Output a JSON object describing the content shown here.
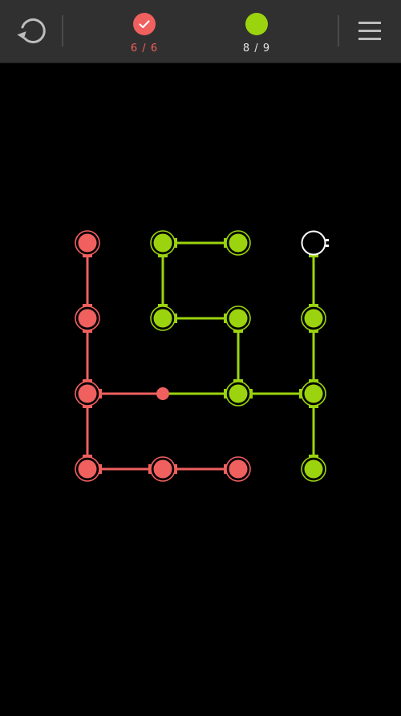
{
  "toolbar": {
    "undo_icon": "undo-arrow-icon",
    "menu_icon": "hamburger-menu-icon"
  },
  "status": {
    "red": {
      "count_text": "6 / 6",
      "color": "#f0605f",
      "complete": true,
      "icon": "check-icon"
    },
    "green": {
      "count_text": "8 / 9",
      "color": "#9bd40e",
      "complete": false
    }
  },
  "colors": {
    "red": "#f0605f",
    "green": "#9bd40e",
    "empty_outline": "#ffffff",
    "topbar": "#303030",
    "icon_gray": "#bdbdbd",
    "background": "#000000"
  },
  "board": {
    "cols": 4,
    "rows": 4,
    "nodes": [
      {
        "id": "r0c0",
        "row": 0,
        "col": 0,
        "color": "red"
      },
      {
        "id": "r0c1",
        "row": 0,
        "col": 1,
        "color": "green"
      },
      {
        "id": "r0c2",
        "row": 0,
        "col": 2,
        "color": "green"
      },
      {
        "id": "r0c3",
        "row": 0,
        "col": 3,
        "color": "empty"
      },
      {
        "id": "r1c0",
        "row": 1,
        "col": 0,
        "color": "red"
      },
      {
        "id": "r1c1",
        "row": 1,
        "col": 1,
        "color": "green"
      },
      {
        "id": "r1c2",
        "row": 1,
        "col": 2,
        "color": "green"
      },
      {
        "id": "r1c3",
        "row": 1,
        "col": 3,
        "color": "green"
      },
      {
        "id": "r2c0",
        "row": 2,
        "col": 0,
        "color": "red"
      },
      {
        "id": "r2c1",
        "row": 2,
        "col": 1,
        "color": "red",
        "small": true
      },
      {
        "id": "r2c2",
        "row": 2,
        "col": 2,
        "color": "green"
      },
      {
        "id": "r2c3",
        "row": 2,
        "col": 3,
        "color": "green"
      },
      {
        "id": "r3c0",
        "row": 3,
        "col": 0,
        "color": "red"
      },
      {
        "id": "r3c1",
        "row": 3,
        "col": 1,
        "color": "red"
      },
      {
        "id": "r3c2",
        "row": 3,
        "col": 2,
        "color": "red"
      },
      {
        "id": "r3c3",
        "row": 3,
        "col": 3,
        "color": "green"
      }
    ],
    "links": [
      {
        "from": "r0c0",
        "to": "r1c0",
        "color": "red"
      },
      {
        "from": "r1c0",
        "to": "r2c0",
        "color": "red"
      },
      {
        "from": "r2c0",
        "to": "r3c0",
        "color": "red"
      },
      {
        "from": "r2c0",
        "to": "r2c1",
        "color": "red"
      },
      {
        "from": "r3c0",
        "to": "r3c1",
        "color": "red"
      },
      {
        "from": "r3c1",
        "to": "r3c2",
        "color": "red"
      },
      {
        "from": "r0c1",
        "to": "r0c2",
        "color": "green"
      },
      {
        "from": "r0c1",
        "to": "r1c1",
        "color": "green"
      },
      {
        "from": "r1c1",
        "to": "r1c2",
        "color": "green"
      },
      {
        "from": "r1c2",
        "to": "r2c2",
        "color": "green"
      },
      {
        "from": "r2c1",
        "to": "r2c2",
        "color": "green"
      },
      {
        "from": "r2c2",
        "to": "r2c3",
        "color": "green"
      },
      {
        "from": "r0c3",
        "to": "r1c3",
        "color": "green"
      },
      {
        "from": "r1c3",
        "to": "r2c3",
        "color": "green"
      },
      {
        "from": "r2c3",
        "to": "r3c3",
        "color": "green"
      }
    ]
  }
}
